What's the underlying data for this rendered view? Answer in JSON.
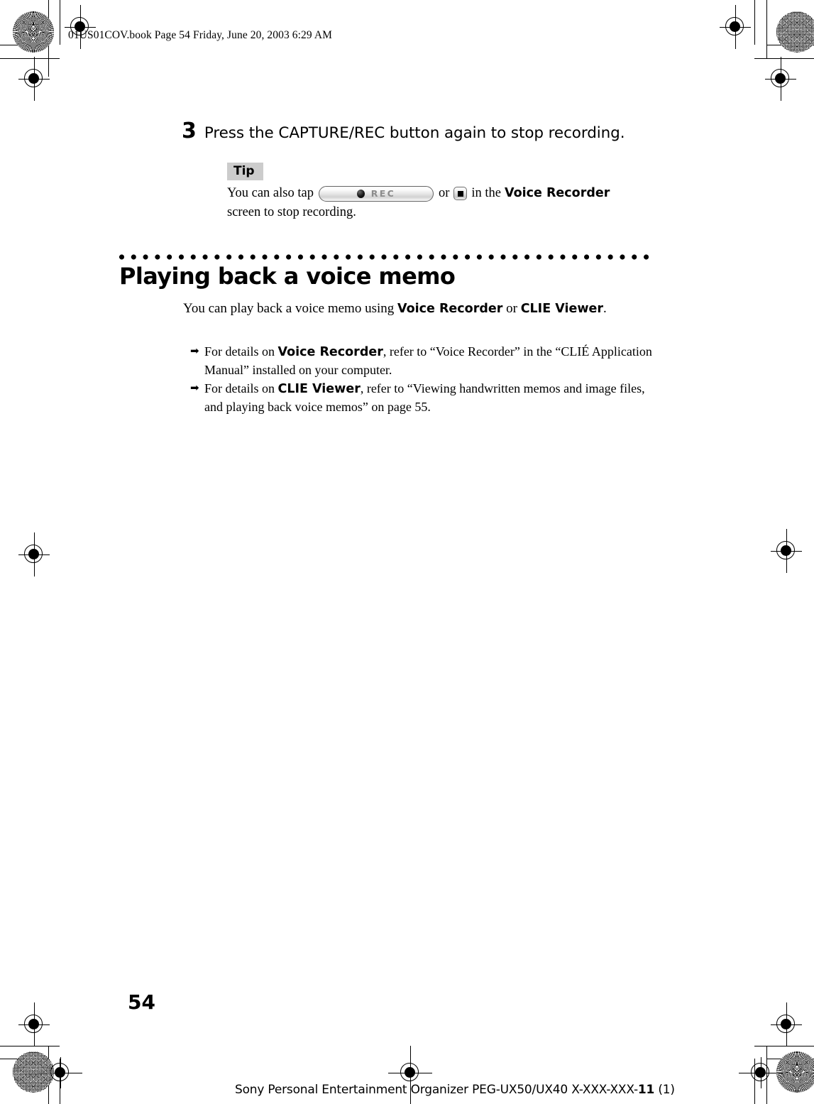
{
  "document": {
    "header_line": "01US01COV.book  Page 54  Friday, June 20, 2003  6:29 AM",
    "page_number": "54",
    "footer_main": "Sony Personal Entertainment Organizer  PEG-UX50/UX40  X-XXX-XXX-",
    "footer_code": "11",
    "footer_rev": " (1)"
  },
  "step": {
    "number": "3",
    "text": "Press the CAPTURE/REC button again to stop recording."
  },
  "tip": {
    "label": "Tip",
    "line1_before": "You can also tap",
    "rec_button_label": "REC",
    "line1_or": "or",
    "line1_after": "in the",
    "app_name": "Voice Recorder",
    "line2": "screen to stop recording."
  },
  "section": {
    "title": "Playing back a voice memo",
    "intro_before": "You can play back a voice memo using ",
    "intro_app1": "Voice Recorder",
    "intro_mid": " or ",
    "intro_app2": "CLIE Viewer",
    "intro_end": "."
  },
  "references": [
    {
      "arrow": "arrow-bullet",
      "before": "For details on ",
      "app": "Voice Recorder",
      "after": ", refer to “Voice Recorder” in the “CLIÉ Application Manual” installed on your computer."
    },
    {
      "arrow": "arrow-bullet",
      "before": "For details on ",
      "app": "CLIE Viewer",
      "after": ", refer to “Viewing handwritten memos and image files, and playing back voice memos” on page 55."
    }
  ],
  "colors": {
    "tip_badge_bg": "#cccccc",
    "rec_text": "#8c8c8c",
    "ink": "#000000",
    "paper": "#ffffff"
  }
}
